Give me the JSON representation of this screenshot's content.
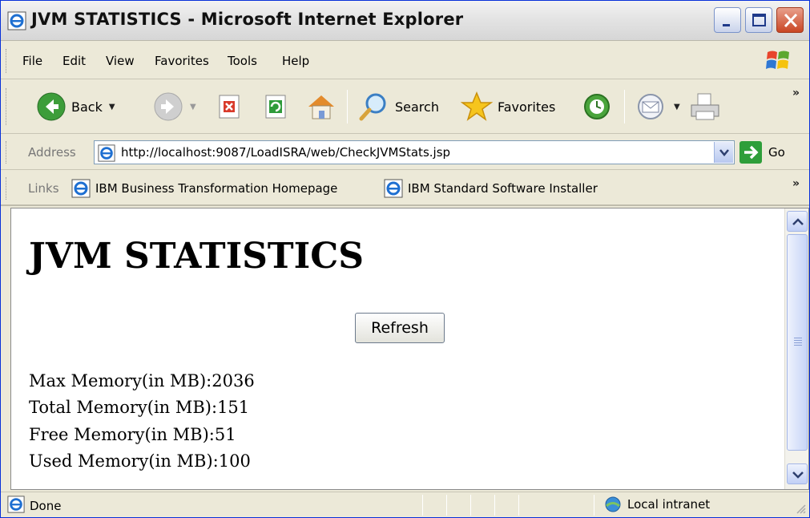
{
  "window": {
    "title": "JVM STATISTICS - Microsoft Internet Explorer"
  },
  "menu": {
    "items": [
      "File",
      "Edit",
      "View",
      "Favorites",
      "Tools",
      "Help"
    ]
  },
  "toolbar": {
    "back_label": "Back",
    "search_label": "Search",
    "favorites_label": "Favorites",
    "overflow": "»"
  },
  "address": {
    "label": "Address",
    "url": "http://localhost:9087/LoadISRA/web/CheckJVMStats.jsp",
    "go_label": "Go"
  },
  "links": {
    "label": "Links",
    "items": [
      "IBM Business Transformation Homepage",
      "IBM Standard Software Installer"
    ],
    "overflow": "»"
  },
  "page": {
    "heading": "JVM STATISTICS",
    "refresh_label": "Refresh",
    "stats": [
      "Max Memory(in MB):2036",
      "Total Memory(in MB):151",
      "Free Memory(in MB):51",
      "Used Memory(in MB):100"
    ]
  },
  "status": {
    "text": "Done",
    "zone": "Local intranet"
  },
  "colors": {
    "chrome": "#ece9d8",
    "close_button": "#c94523",
    "go_button": "#2e9e3a"
  }
}
